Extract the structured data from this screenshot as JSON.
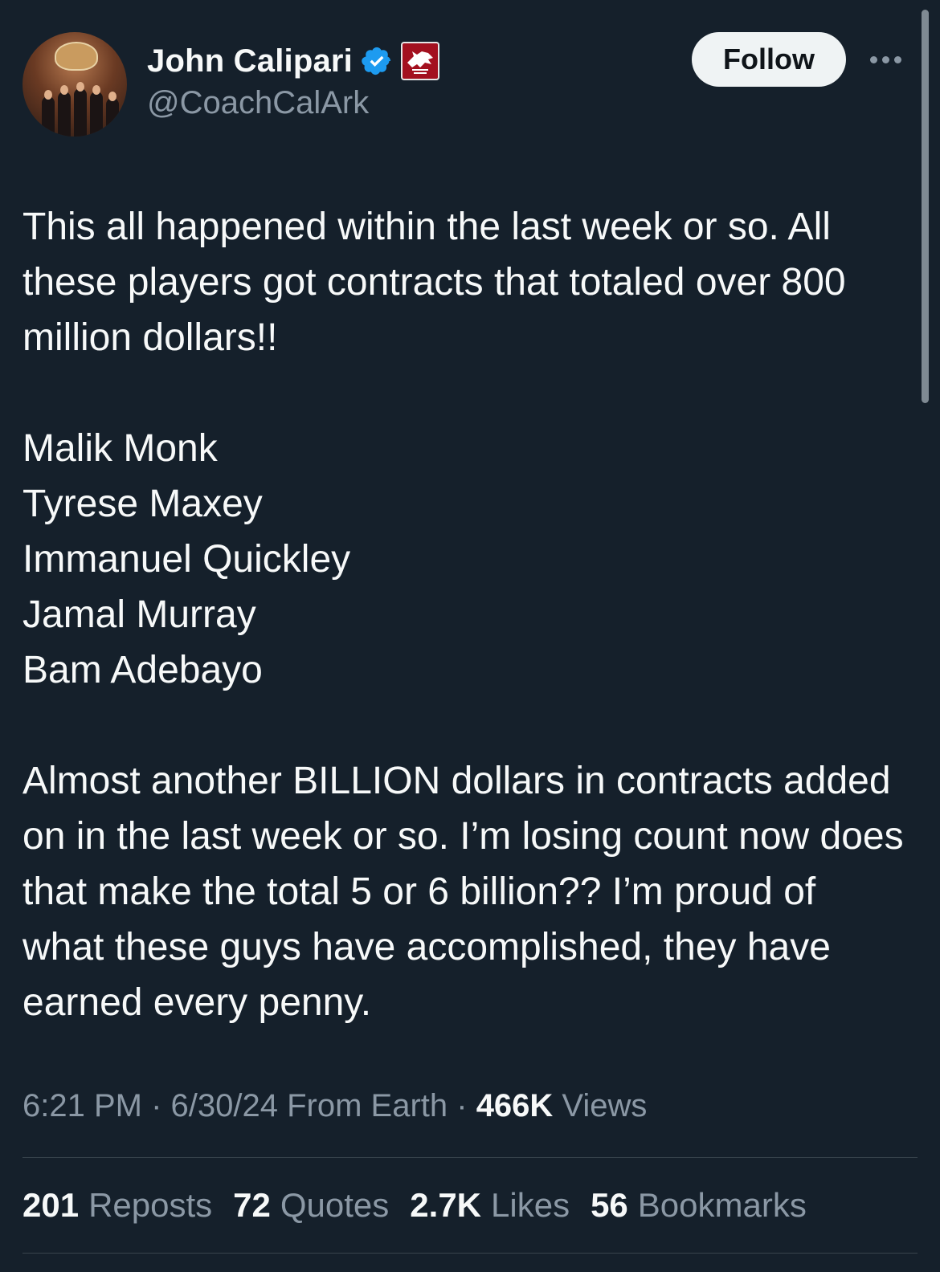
{
  "author": {
    "name": "John Calipari",
    "handle": "@CoachCalArk",
    "verified_icon": "verified-check-icon",
    "affiliation_icon": "razorback-badge-icon"
  },
  "follow_label": "Follow",
  "more_icon": "more-options-icon",
  "tweet": {
    "p1": "This all happened within the last week or so. All these players got contracts that totaled over 800 million dollars!!",
    "players": [
      "Malik Monk",
      "Tyrese Maxey",
      "Immanuel Quickley",
      "Jamal Murray",
      "Bam Adebayo"
    ],
    "p3": "Almost another BILLION dollars in contracts added on in the last week or so. I’m losing count now does that make the total 5 or 6 billion?? I’m proud of what these guys have accomplished, they have earned every penny."
  },
  "meta": {
    "time": "6:21 PM",
    "sep1": " · ",
    "date": "6/30/24",
    "location": " From Earth",
    "sep2": " · ",
    "views_count": "466K",
    "views_label": " Views"
  },
  "stats": [
    {
      "count": "201",
      "label": "Reposts"
    },
    {
      "count": "72",
      "label": "Quotes"
    },
    {
      "count": "2.7K",
      "label": "Likes"
    },
    {
      "count": "56",
      "label": "Bookmarks"
    }
  ],
  "colors": {
    "background": "#15202b",
    "text": "#f7f9f9",
    "secondary": "#8b98a5",
    "verified": "#1d9bf0",
    "badge": "#a3101f"
  }
}
